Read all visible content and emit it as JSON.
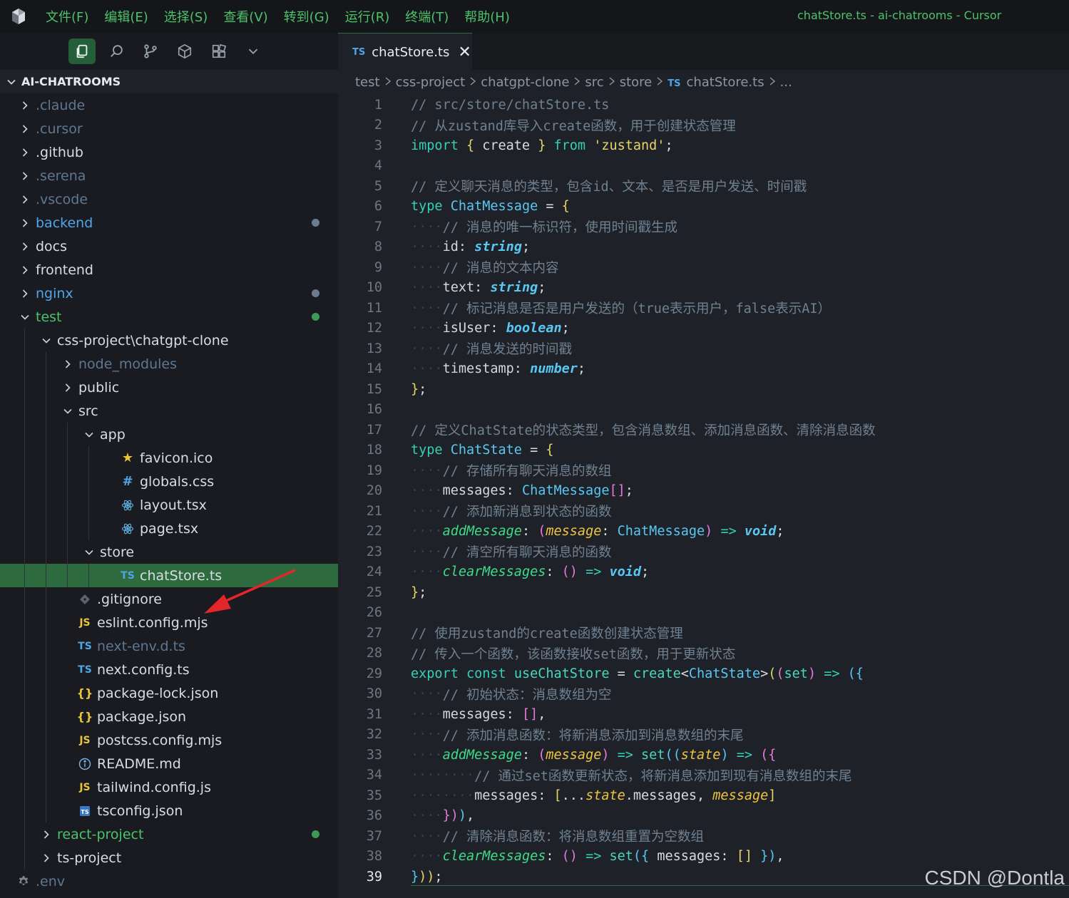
{
  "titlebar": {
    "menu": [
      "文件(F)",
      "编辑(E)",
      "选择(S)",
      "查看(V)",
      "转到(G)",
      "运行(R)",
      "终端(T)",
      "帮助(H)"
    ],
    "window_title": "chatStore.ts - ai-chatrooms - Cursor"
  },
  "sidebar": {
    "explorer_title": "AI-CHATROOMS",
    "items": [
      {
        "label": ".claude",
        "depth": 0,
        "kind": "folder",
        "expanded": false,
        "color": "dim"
      },
      {
        "label": ".cursor",
        "depth": 0,
        "kind": "folder",
        "expanded": false,
        "color": "dim"
      },
      {
        "label": ".github",
        "depth": 0,
        "kind": "folder",
        "expanded": false,
        "color": "norm"
      },
      {
        "label": ".serena",
        "depth": 0,
        "kind": "folder",
        "expanded": false,
        "color": "dim"
      },
      {
        "label": ".vscode",
        "depth": 0,
        "kind": "folder",
        "expanded": false,
        "color": "dim"
      },
      {
        "label": "backend",
        "depth": 0,
        "kind": "folder",
        "expanded": false,
        "color": "blue",
        "dot": "#6a7c8e"
      },
      {
        "label": "docs",
        "depth": 0,
        "kind": "folder",
        "expanded": false,
        "color": "norm"
      },
      {
        "label": "frontend",
        "depth": 0,
        "kind": "folder",
        "expanded": false,
        "color": "norm"
      },
      {
        "label": "nginx",
        "depth": 0,
        "kind": "folder",
        "expanded": false,
        "color": "blue",
        "dot": "#6a7c8e"
      },
      {
        "label": "test",
        "depth": 0,
        "kind": "folder",
        "expanded": true,
        "color": "green",
        "dot": "#3c9a55"
      },
      {
        "label": "css-project\\chatgpt-clone",
        "depth": 1,
        "kind": "folder",
        "expanded": true,
        "color": "norm"
      },
      {
        "label": "node_modules",
        "depth": 2,
        "kind": "folder",
        "expanded": false,
        "color": "dim"
      },
      {
        "label": "public",
        "depth": 2,
        "kind": "folder",
        "expanded": false,
        "color": "norm"
      },
      {
        "label": "src",
        "depth": 2,
        "kind": "folder",
        "expanded": true,
        "color": "norm"
      },
      {
        "label": "app",
        "depth": 3,
        "kind": "folder",
        "expanded": true,
        "color": "norm"
      },
      {
        "label": "favicon.ico",
        "depth": 4,
        "kind": "file",
        "icon": "star-icon",
        "color": "norm"
      },
      {
        "label": "globals.css",
        "depth": 4,
        "kind": "file",
        "icon": "hash-icon",
        "color": "norm"
      },
      {
        "label": "layout.tsx",
        "depth": 4,
        "kind": "file",
        "icon": "react-icon",
        "color": "norm"
      },
      {
        "label": "page.tsx",
        "depth": 4,
        "kind": "file",
        "icon": "react-icon",
        "color": "norm"
      },
      {
        "label": "store",
        "depth": 3,
        "kind": "folder",
        "expanded": true,
        "color": "norm"
      },
      {
        "label": "chatStore.ts",
        "depth": 4,
        "kind": "file",
        "icon": "ts-icon",
        "color": "norm",
        "selected": true
      },
      {
        "label": ".gitignore",
        "depth": 2,
        "kind": "file",
        "icon": "git-icon",
        "color": "norm"
      },
      {
        "label": "eslint.config.mjs",
        "depth": 2,
        "kind": "file",
        "icon": "js-icon",
        "color": "norm"
      },
      {
        "label": "next-env.d.ts",
        "depth": 2,
        "kind": "file",
        "icon": "ts-icon",
        "color": "dim"
      },
      {
        "label": "next.config.ts",
        "depth": 2,
        "kind": "file",
        "icon": "ts-icon",
        "color": "norm"
      },
      {
        "label": "package-lock.json",
        "depth": 2,
        "kind": "file",
        "icon": "json-icon",
        "color": "norm"
      },
      {
        "label": "package.json",
        "depth": 2,
        "kind": "file",
        "icon": "json-icon",
        "color": "norm"
      },
      {
        "label": "postcss.config.mjs",
        "depth": 2,
        "kind": "file",
        "icon": "js-icon",
        "color": "norm"
      },
      {
        "label": "README.md",
        "depth": 2,
        "kind": "file",
        "icon": "info-icon",
        "color": "norm"
      },
      {
        "label": "tailwind.config.js",
        "depth": 2,
        "kind": "file",
        "icon": "js-icon",
        "color": "norm"
      },
      {
        "label": "tsconfig.json",
        "depth": 2,
        "kind": "file",
        "icon": "tsconfig-icon",
        "color": "norm"
      },
      {
        "label": "react-project",
        "depth": 1,
        "kind": "folder",
        "expanded": false,
        "color": "green",
        "dot": "#3c9a55"
      },
      {
        "label": "ts-project",
        "depth": 1,
        "kind": "folder",
        "expanded": false,
        "color": "norm"
      },
      {
        "label": ".env",
        "depth": 0,
        "kind": "file",
        "icon": "gear-icon",
        "color": "dim"
      }
    ]
  },
  "editor": {
    "tab": {
      "badge": "TS",
      "label": "chatStore.ts",
      "close": "✕"
    },
    "breadcrumb": [
      "test",
      "css-project",
      "chatgpt-clone",
      "src",
      "store"
    ],
    "breadcrumb_file": {
      "badge": "TS",
      "label": "chatStore.ts"
    },
    "breadcrumb_more": "...",
    "current_line": 39,
    "lines": [
      [
        [
          "comment",
          "// src/store/chatStore.ts"
        ]
      ],
      [
        [
          "comment",
          "// 从zustand库导入create函数，用于创建状态管理"
        ]
      ],
      [
        [
          "kw",
          "import"
        ],
        [
          "plain",
          " "
        ],
        [
          "brace",
          "{"
        ],
        [
          "plain",
          " create "
        ],
        [
          "brace",
          "}"
        ],
        [
          "plain",
          " "
        ],
        [
          "kw",
          "from"
        ],
        [
          "plain",
          " "
        ],
        [
          "str",
          "'zustand'"
        ],
        [
          "plain",
          ";"
        ]
      ],
      [],
      [
        [
          "comment",
          "// 定义聊天消息的类型，包含id、文本、是否是用户发送、时间戳"
        ]
      ],
      [
        [
          "kw",
          "type"
        ],
        [
          "plain",
          " "
        ],
        [
          "type",
          "ChatMessage"
        ],
        [
          "plain",
          " = "
        ],
        [
          "brace",
          "{"
        ]
      ],
      [
        [
          "ws",
          "····"
        ],
        [
          "comment",
          "// 消息的唯一标识符，使用时间戳生成"
        ]
      ],
      [
        [
          "ws",
          "····"
        ],
        [
          "prop",
          "id: "
        ],
        [
          "itype",
          "string"
        ],
        [
          "plain",
          ";"
        ]
      ],
      [
        [
          "ws",
          "····"
        ],
        [
          "comment",
          "// 消息的文本内容"
        ]
      ],
      [
        [
          "ws",
          "····"
        ],
        [
          "prop",
          "text: "
        ],
        [
          "itype",
          "string"
        ],
        [
          "plain",
          ";"
        ]
      ],
      [
        [
          "ws",
          "····"
        ],
        [
          "comment",
          "// 标记消息是否是用户发送的（true表示用户，false表示AI）"
        ]
      ],
      [
        [
          "ws",
          "····"
        ],
        [
          "prop",
          "isUser: "
        ],
        [
          "itype",
          "boolean"
        ],
        [
          "plain",
          ";"
        ]
      ],
      [
        [
          "ws",
          "····"
        ],
        [
          "comment",
          "// 消息发送的时间戳"
        ]
      ],
      [
        [
          "ws",
          "····"
        ],
        [
          "prop",
          "timestamp: "
        ],
        [
          "itype",
          "number"
        ],
        [
          "plain",
          ";"
        ]
      ],
      [
        [
          "brace",
          "}"
        ],
        [
          "plain",
          ";"
        ]
      ],
      [],
      [
        [
          "comment",
          "// 定义ChatState的状态类型，包含消息数组、添加消息函数、清除消息函数"
        ]
      ],
      [
        [
          "kw",
          "type"
        ],
        [
          "plain",
          " "
        ],
        [
          "type",
          "ChatState"
        ],
        [
          "plain",
          " = "
        ],
        [
          "brace",
          "{"
        ]
      ],
      [
        [
          "ws",
          "····"
        ],
        [
          "comment",
          "// 存储所有聊天消息的数组"
        ]
      ],
      [
        [
          "ws",
          "····"
        ],
        [
          "prop",
          "messages: "
        ],
        [
          "type",
          "ChatMessage"
        ],
        [
          "paren",
          "[]"
        ],
        [
          "plain",
          ";"
        ]
      ],
      [
        [
          "ws",
          "····"
        ],
        [
          "comment",
          "// 添加新消息到状态的函数"
        ]
      ],
      [
        [
          "ws",
          "····"
        ],
        [
          "method",
          "addMessage"
        ],
        [
          "plain",
          ": "
        ],
        [
          "paren",
          "("
        ],
        [
          "param",
          "message"
        ],
        [
          "plain",
          ": "
        ],
        [
          "type",
          "ChatMessage"
        ],
        [
          "paren",
          ")"
        ],
        [
          "plain",
          " "
        ],
        [
          "arrow",
          "=>"
        ],
        [
          "plain",
          " "
        ],
        [
          "itype",
          "void"
        ],
        [
          "plain",
          ";"
        ]
      ],
      [
        [
          "ws",
          "····"
        ],
        [
          "comment",
          "// 清空所有聊天消息的函数"
        ]
      ],
      [
        [
          "ws",
          "····"
        ],
        [
          "method",
          "clearMessages"
        ],
        [
          "plain",
          ": "
        ],
        [
          "paren",
          "()"
        ],
        [
          "plain",
          " "
        ],
        [
          "arrow",
          "=>"
        ],
        [
          "plain",
          " "
        ],
        [
          "itype",
          "void"
        ],
        [
          "plain",
          ";"
        ]
      ],
      [
        [
          "brace",
          "}"
        ],
        [
          "plain",
          ";"
        ]
      ],
      [],
      [
        [
          "comment",
          "// 使用zustand的create函数创建状态管理"
        ]
      ],
      [
        [
          "comment",
          "// 传入一个函数，该函数接收set函数，用于更新状态"
        ]
      ],
      [
        [
          "kw",
          "export"
        ],
        [
          "plain",
          " "
        ],
        [
          "kw",
          "const"
        ],
        [
          "plain",
          " "
        ],
        [
          "fn",
          "useChatStore"
        ],
        [
          "plain",
          " = "
        ],
        [
          "fn",
          "create"
        ],
        [
          "plain",
          "<"
        ],
        [
          "type",
          "ChatState"
        ],
        [
          "plain",
          ">"
        ],
        [
          "brace",
          "("
        ],
        [
          "paren",
          "("
        ],
        [
          "fn",
          "set"
        ],
        [
          "paren",
          ")"
        ],
        [
          "plain",
          " "
        ],
        [
          "arrow",
          "=>"
        ],
        [
          "plain",
          " "
        ],
        [
          "type",
          "({"
        ]
      ],
      [
        [
          "ws",
          "····"
        ],
        [
          "comment",
          "// 初始状态：消息数组为空"
        ]
      ],
      [
        [
          "ws",
          "····"
        ],
        [
          "prop",
          "messages: "
        ],
        [
          "paren",
          "[]"
        ],
        [
          "plain",
          ","
        ]
      ],
      [
        [
          "ws",
          "····"
        ],
        [
          "comment",
          "// 添加消息函数：将新消息添加到消息数组的末尾"
        ]
      ],
      [
        [
          "ws",
          "····"
        ],
        [
          "method",
          "addMessage"
        ],
        [
          "plain",
          ": "
        ],
        [
          "paren",
          "("
        ],
        [
          "param",
          "message"
        ],
        [
          "paren",
          ")"
        ],
        [
          "plain",
          " "
        ],
        [
          "arrow",
          "=>"
        ],
        [
          "plain",
          " "
        ],
        [
          "fn",
          "set"
        ],
        [
          "type",
          "(("
        ],
        [
          "param",
          "state"
        ],
        [
          "type",
          ")"
        ],
        [
          "plain",
          " "
        ],
        [
          "arrow",
          "=>"
        ],
        [
          "plain",
          " "
        ],
        [
          "paren",
          "({"
        ]
      ],
      [
        [
          "ws",
          "········"
        ],
        [
          "comment",
          "// 通过set函数更新状态，将新消息添加到现有消息数组的末尾"
        ]
      ],
      [
        [
          "ws",
          "········"
        ],
        [
          "prop",
          "messages: "
        ],
        [
          "brace",
          "["
        ],
        [
          "plain",
          "..."
        ],
        [
          "param",
          "state"
        ],
        [
          "plain",
          ".messages, "
        ],
        [
          "param",
          "message"
        ],
        [
          "brace",
          "]"
        ]
      ],
      [
        [
          "ws",
          "····"
        ],
        [
          "paren",
          "})"
        ],
        [
          "type",
          ")"
        ],
        [
          "plain",
          ","
        ]
      ],
      [
        [
          "ws",
          "····"
        ],
        [
          "comment",
          "// 清除消息函数：将消息数组重置为空数组"
        ]
      ],
      [
        [
          "ws",
          "····"
        ],
        [
          "method",
          "clearMessages"
        ],
        [
          "plain",
          ": "
        ],
        [
          "paren",
          "()"
        ],
        [
          "plain",
          " "
        ],
        [
          "arrow",
          "=>"
        ],
        [
          "plain",
          " "
        ],
        [
          "fn",
          "set"
        ],
        [
          "type",
          "({"
        ],
        [
          "plain",
          " messages: "
        ],
        [
          "brace",
          "[]"
        ],
        [
          "plain",
          " "
        ],
        [
          "type",
          "})"
        ],
        [
          "plain",
          ","
        ]
      ],
      [
        [
          "type",
          "}"
        ],
        [
          "brace",
          "))"
        ],
        [
          "plain",
          ";"
        ]
      ]
    ]
  },
  "watermark": "CSDN @Dontla",
  "colors": {
    "accent": "#4cc36b",
    "selection": "#2d6a3d",
    "ts_badge": "#4ea6e8",
    "annotation_arrow": "#e3262b"
  }
}
